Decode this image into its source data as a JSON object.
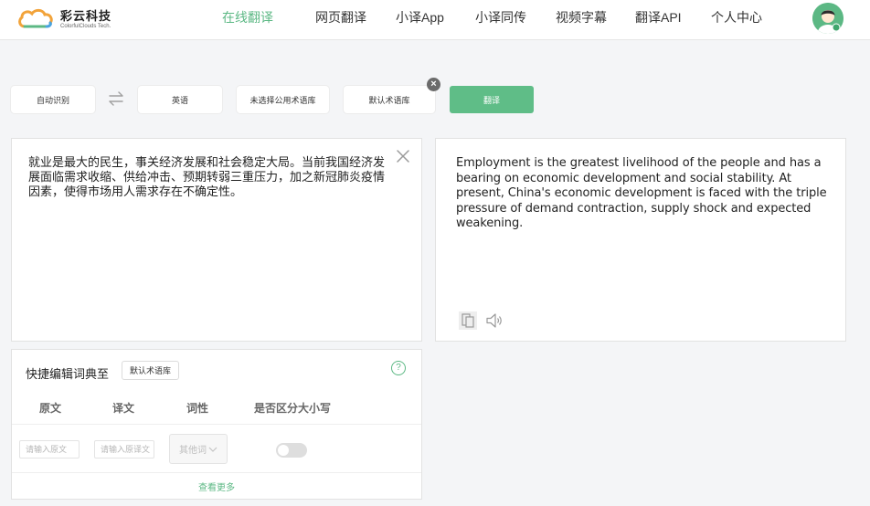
{
  "header": {
    "logo_cn": "彩云科技",
    "logo_en": "ColorfulClouds Tech.",
    "nav": [
      {
        "label": "在线翻译",
        "active": true
      },
      {
        "label": "网页翻译",
        "active": false
      },
      {
        "label": "小译App",
        "active": false
      },
      {
        "label": "小译同传",
        "active": false
      },
      {
        "label": "视频字幕",
        "active": false
      },
      {
        "label": "翻译API",
        "active": false
      },
      {
        "label": "个人中心",
        "active": false
      }
    ],
    "avatar_icon": "user-avatar-icon"
  },
  "toolbar": {
    "source_lang": "自动识别",
    "swap_icon": "swap-arrows-icon",
    "target_lang": "英语",
    "public_glossary": "未选择公用术语库",
    "default_glossary": "默认术语库",
    "clear_icon": "close-circle-icon",
    "translate_label": "翻译"
  },
  "source": {
    "text": "就业是最大的民生，事关经济发展和社会稳定大局。当前我国经济发展面临需求收缩、供给冲击、预期转弱三重压力，加之新冠肺炎疫情因素，使得市场用人需求存在不确定性。",
    "clear_icon": "close-icon"
  },
  "result": {
    "text": "Employment is the greatest livelihood of the people and has a bearing on economic development and social stability. At present, China's economic development is faced with the triple pressure of demand contraction, supply shock and expected weakening.",
    "copy_icon": "copy-icon",
    "speaker_icon": "speaker-icon"
  },
  "quick_edit": {
    "title": "快捷编辑词典至",
    "glossary": "默认术语库",
    "help_icon": "help-icon",
    "help_glyph": "?",
    "columns": [
      "原文",
      "译文",
      "词性",
      "是否区分大小写"
    ],
    "source_placeholder": "请输入原文",
    "target_placeholder": "请输入原译文",
    "pos_value": "其他词",
    "case_sensitive": false,
    "more": "查看更多"
  },
  "colors": {
    "accent": "#5cb884",
    "translate_button": "#5fbd87"
  }
}
